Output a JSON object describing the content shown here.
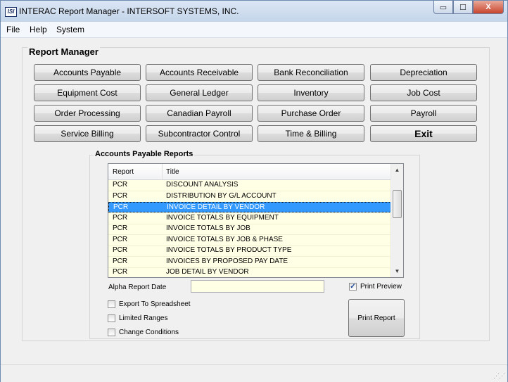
{
  "window": {
    "icon_text": "ISI",
    "title": "INTERAC Report Manager - INTERSOFT SYSTEMS, INC.",
    "minimize_glyph": "▭",
    "maximize_glyph": "☐",
    "close_glyph": "X"
  },
  "menu": [
    "File",
    "Help",
    "System"
  ],
  "report_manager": {
    "title": "Report Manager",
    "buttons": [
      "Accounts Payable",
      "Accounts Receivable",
      "Bank Reconciliation",
      "Depreciation",
      "Equipment Cost",
      "General Ledger",
      "Inventory",
      "Job Cost",
      "Order Processing",
      "Canadian Payroll",
      "Purchase Order",
      "Payroll",
      "Service Billing",
      "Subcontractor Control",
      "Time & Billing",
      "Exit"
    ]
  },
  "reports": {
    "title": "Accounts Payable Reports",
    "columns": {
      "report": "Report",
      "title": "Title"
    },
    "rows": [
      {
        "report": "PCR",
        "title": "DISCOUNT ANALYSIS"
      },
      {
        "report": "PCR",
        "title": "DISTRIBUTION BY G/L ACCOUNT"
      },
      {
        "report": "PCR",
        "title": "INVOICE DETAIL BY VENDOR",
        "selected": true
      },
      {
        "report": "PCR",
        "title": "INVOICE TOTALS BY EQUIPMENT"
      },
      {
        "report": "PCR",
        "title": "INVOICE TOTALS BY JOB"
      },
      {
        "report": "PCR",
        "title": "INVOICE TOTALS BY JOB & PHASE"
      },
      {
        "report": "PCR",
        "title": "INVOICE TOTALS BY PRODUCT TYPE"
      },
      {
        "report": "PCR",
        "title": "INVOICES BY PROPOSED PAY DATE"
      },
      {
        "report": "PCR",
        "title": "JOB DETAIL BY VENDOR"
      }
    ],
    "alpha_report_date_label": "Alpha Report Date",
    "alpha_report_date_value": "",
    "print_preview": {
      "label": "Print Preview",
      "checked": true
    },
    "export_to_spreadsheet": {
      "label": "Export To Spreadsheet",
      "checked": false
    },
    "limited_ranges": {
      "label": "Limited Ranges",
      "checked": false
    },
    "change_conditions": {
      "label": "Change Conditions",
      "checked": false
    },
    "print_button": "Print Report"
  },
  "colors": {
    "selection": "#3399ff",
    "list_background": "#ffffe6"
  }
}
